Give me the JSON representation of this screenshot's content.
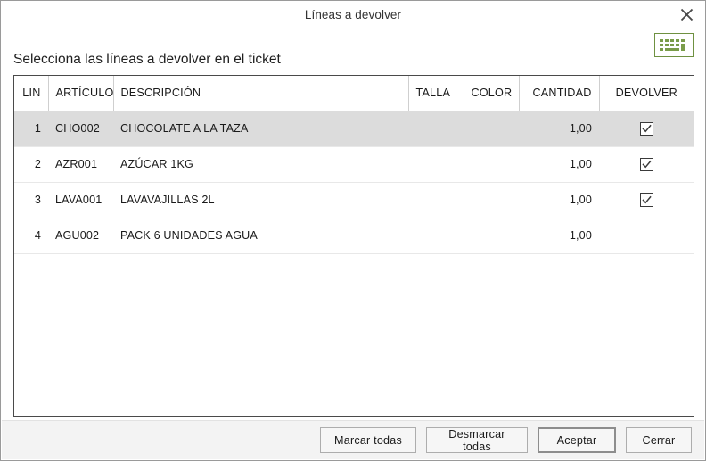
{
  "window": {
    "title": "Líneas a devolver",
    "close_icon": "close-icon"
  },
  "keyboard_toggle": {
    "icon": "keyboard-icon",
    "color": "#6f9141"
  },
  "instruction": "Selecciona las líneas a devolver en el ticket",
  "table": {
    "columns": [
      {
        "key": "lin",
        "label": "LIN"
      },
      {
        "key": "articulo",
        "label": "ARTÍCULO"
      },
      {
        "key": "descripcion",
        "label": "DESCRIPCIÓN"
      },
      {
        "key": "talla",
        "label": "TALLA"
      },
      {
        "key": "color",
        "label": "COLOR"
      },
      {
        "key": "cantidad",
        "label": "CANTIDAD"
      },
      {
        "key": "devolver",
        "label": "DEVOLVER"
      }
    ],
    "rows": [
      {
        "lin": "1",
        "articulo": "CHO002",
        "descripcion": "CHOCOLATE A LA TAZA",
        "talla": "",
        "color": "",
        "cantidad": "1,00",
        "devolver_checked": true,
        "selected": true,
        "disabled": false
      },
      {
        "lin": "2",
        "articulo": "AZR001",
        "descripcion": "AZÚCAR 1KG",
        "talla": "",
        "color": "",
        "cantidad": "1,00",
        "devolver_checked": true,
        "selected": false,
        "disabled": false
      },
      {
        "lin": "3",
        "articulo": "LAVA001",
        "descripcion": "LAVAVAJILLAS 2L",
        "talla": "",
        "color": "",
        "cantidad": "1,00",
        "devolver_checked": true,
        "selected": false,
        "disabled": false
      },
      {
        "lin": "4",
        "articulo": "AGU002",
        "descripcion": "PACK 6 UNIDADES AGUA",
        "talla": "",
        "color": "",
        "cantidad": "1,00",
        "devolver_checked": false,
        "selected": false,
        "disabled": true
      }
    ]
  },
  "footer": {
    "mark_all": "Marcar todas",
    "unmark_all": "Desmarcar todas",
    "accept": "Aceptar",
    "close": "Cerrar"
  },
  "colors": {
    "selected_row": "#dcdcdc",
    "disabled_text": "#a6a6a6",
    "footer_bg": "#f3f3f3",
    "accent_green": "#6f9141"
  }
}
